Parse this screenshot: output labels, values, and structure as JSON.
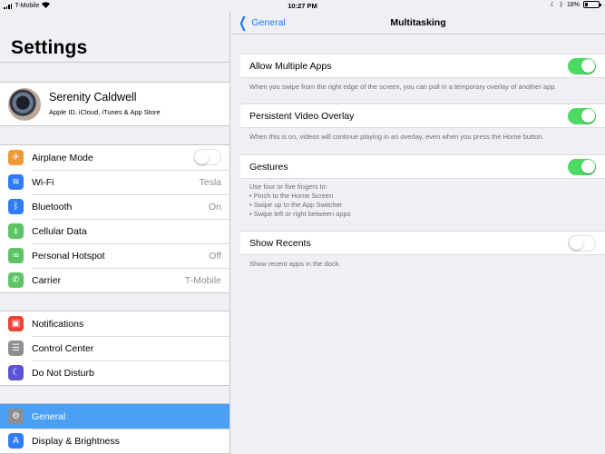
{
  "status_bar": {
    "carrier": "T-Mobile",
    "time": "10:27 PM",
    "battery": "18%",
    "battery_level": 0.18
  },
  "sidebar": {
    "title": "Settings",
    "profile": {
      "name": "Serenity Caldwell",
      "subtitle": "Apple ID, iCloud, iTunes & App Store"
    },
    "group1": [
      {
        "label": "Airplane Mode",
        "icon": "airplane-icon",
        "color": "#f09a37",
        "toggle": false
      },
      {
        "label": "Wi-Fi",
        "value": "Tesla",
        "icon": "wifi-icon",
        "color": "#2f7cf6"
      },
      {
        "label": "Bluetooth",
        "value": "On",
        "icon": "bluetooth-icon",
        "color": "#2f7cf6"
      },
      {
        "label": "Cellular Data",
        "icon": "cellular-icon",
        "color": "#5dc466"
      },
      {
        "label": "Personal Hotspot",
        "value": "Off",
        "icon": "hotspot-icon",
        "color": "#5dc466"
      },
      {
        "label": "Carrier",
        "value": "T-Mobile",
        "icon": "phone-icon",
        "color": "#5dc466"
      }
    ],
    "group2": [
      {
        "label": "Notifications",
        "icon": "notifications-icon",
        "color": "#ec4336"
      },
      {
        "label": "Control Center",
        "icon": "control-center-icon",
        "color": "#8e8e93"
      },
      {
        "label": "Do Not Disturb",
        "icon": "moon-icon",
        "color": "#5b55d6"
      }
    ],
    "group3": [
      {
        "label": "General",
        "icon": "gear-icon",
        "color": "#8e8e93",
        "selected": true
      },
      {
        "label": "Display & Brightness",
        "icon": "display-icon",
        "color": "#2f7cf6"
      }
    ]
  },
  "detail": {
    "back_label": "General",
    "title": "Multitasking",
    "settings": [
      {
        "label": "Allow Multiple Apps",
        "on": true,
        "footer": [
          "When you swipe from the right edge of the screen, you can pull in a temporary overlay of another app."
        ]
      },
      {
        "label": "Persistent Video Overlay",
        "on": true,
        "footer": [
          "When this is on, videos will continue playing in an overlay, even when you press the Home button."
        ]
      },
      {
        "label": "Gestures",
        "on": true,
        "footer": [
          "Use four or five fingers to:",
          "• Pinch to the Home Screen",
          "• Swipe up to the App Switcher",
          "• Swipe left or right between apps"
        ]
      },
      {
        "label": "Show Recents",
        "on": false,
        "footer": [
          "Show recent apps in the dock."
        ]
      }
    ]
  }
}
